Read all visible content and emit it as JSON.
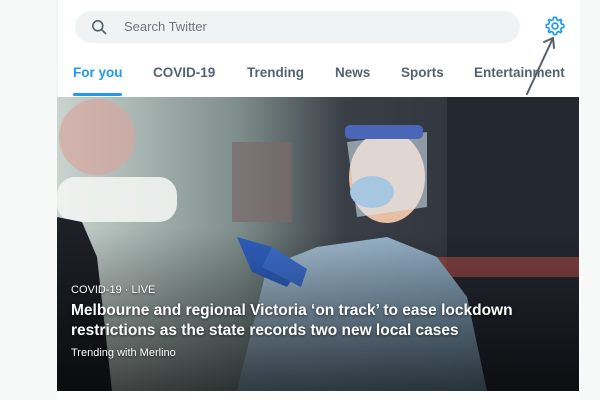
{
  "search": {
    "placeholder": "Search Twitter"
  },
  "tabs": [
    {
      "label": "For you",
      "active": true
    },
    {
      "label": "COVID-19",
      "active": false
    },
    {
      "label": "Trending",
      "active": false
    },
    {
      "label": "News",
      "active": false
    },
    {
      "label": "Sports",
      "active": false
    },
    {
      "label": "Entertainment",
      "active": false
    }
  ],
  "hero": {
    "kicker": "COVID-19 · LIVE",
    "headline": "Melbourne and regional Victoria ‘on track’ to ease lockdown restrictions as the state records two new local cases",
    "trending": "Trending with  Merlino"
  },
  "icons": {
    "search": "search-icon",
    "settings": "gear-icon",
    "annotation": "arrow-annotation-icon"
  },
  "colors": {
    "accent": "#1d9bf0",
    "tab_text": "#536471",
    "search_bg": "#eff3f4"
  }
}
